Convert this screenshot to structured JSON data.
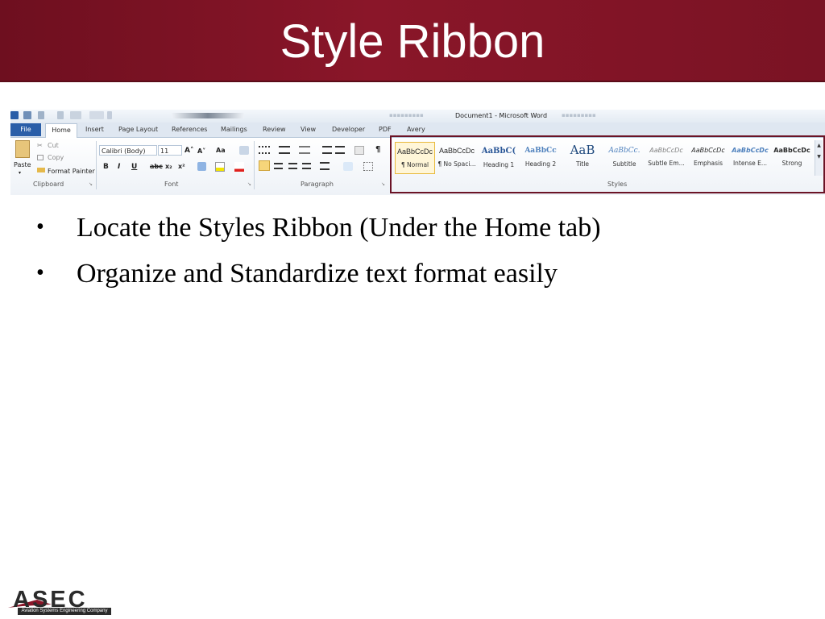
{
  "slide": {
    "title": "Style Ribbon",
    "bullets": [
      "Locate the Styles Ribbon (Under the Home tab)",
      "Organize and Standardize text format easily"
    ],
    "bullet_glyph": "•"
  },
  "logo": {
    "word": "ASEC",
    "subtitle": "Aviation Systems Engineering Company"
  },
  "word_window": {
    "title": "Document1 - Microsoft Word",
    "tabs": [
      "File",
      "Home",
      "Insert",
      "Page Layout",
      "References",
      "Mailings",
      "Review",
      "View",
      "Developer",
      "PDF",
      "Avery"
    ],
    "active_tab": "Home",
    "clipboard": {
      "paste": "Paste",
      "cut": "Cut",
      "copy": "Copy",
      "format_painter": "Format Painter",
      "label": "Clipboard"
    },
    "font": {
      "family": "Calibri (Body)",
      "size": "11",
      "label": "Font",
      "bold": "B",
      "italic": "I",
      "underline": "U",
      "strike": "abc",
      "subscript": "x₂",
      "superscript": "x²",
      "grow": "A˄",
      "shrink": "A˅",
      "case": "Aa"
    },
    "paragraph": {
      "label": "Paragraph",
      "pilcrow": "¶"
    },
    "styles": {
      "label": "Styles",
      "items": [
        {
          "sample": "AaBbCcDc",
          "name": "¶ Normal",
          "selected": true
        },
        {
          "sample": "AaBbCcDc",
          "name": "¶ No Spaci..."
        },
        {
          "sample": "AaBbC(",
          "name": "Heading 1"
        },
        {
          "sample": "AaBbCc",
          "name": "Heading 2"
        },
        {
          "sample": "AaB",
          "name": "Title"
        },
        {
          "sample": "AaBbCc.",
          "name": "Subtitle"
        },
        {
          "sample": "AaBbCcDc",
          "name": "Subtle Em..."
        },
        {
          "sample": "AaBbCcDc",
          "name": "Emphasis"
        },
        {
          "sample": "AaBbCcDc",
          "name": "Intense E..."
        },
        {
          "sample": "AaBbCcDc",
          "name": "Strong"
        }
      ]
    }
  },
  "colors": {
    "title_bar": "#7a1324",
    "highlight_box": "#6b1326",
    "file_tab": "#2a5ea8",
    "ribbon_tabs": "#dfe7f1"
  }
}
